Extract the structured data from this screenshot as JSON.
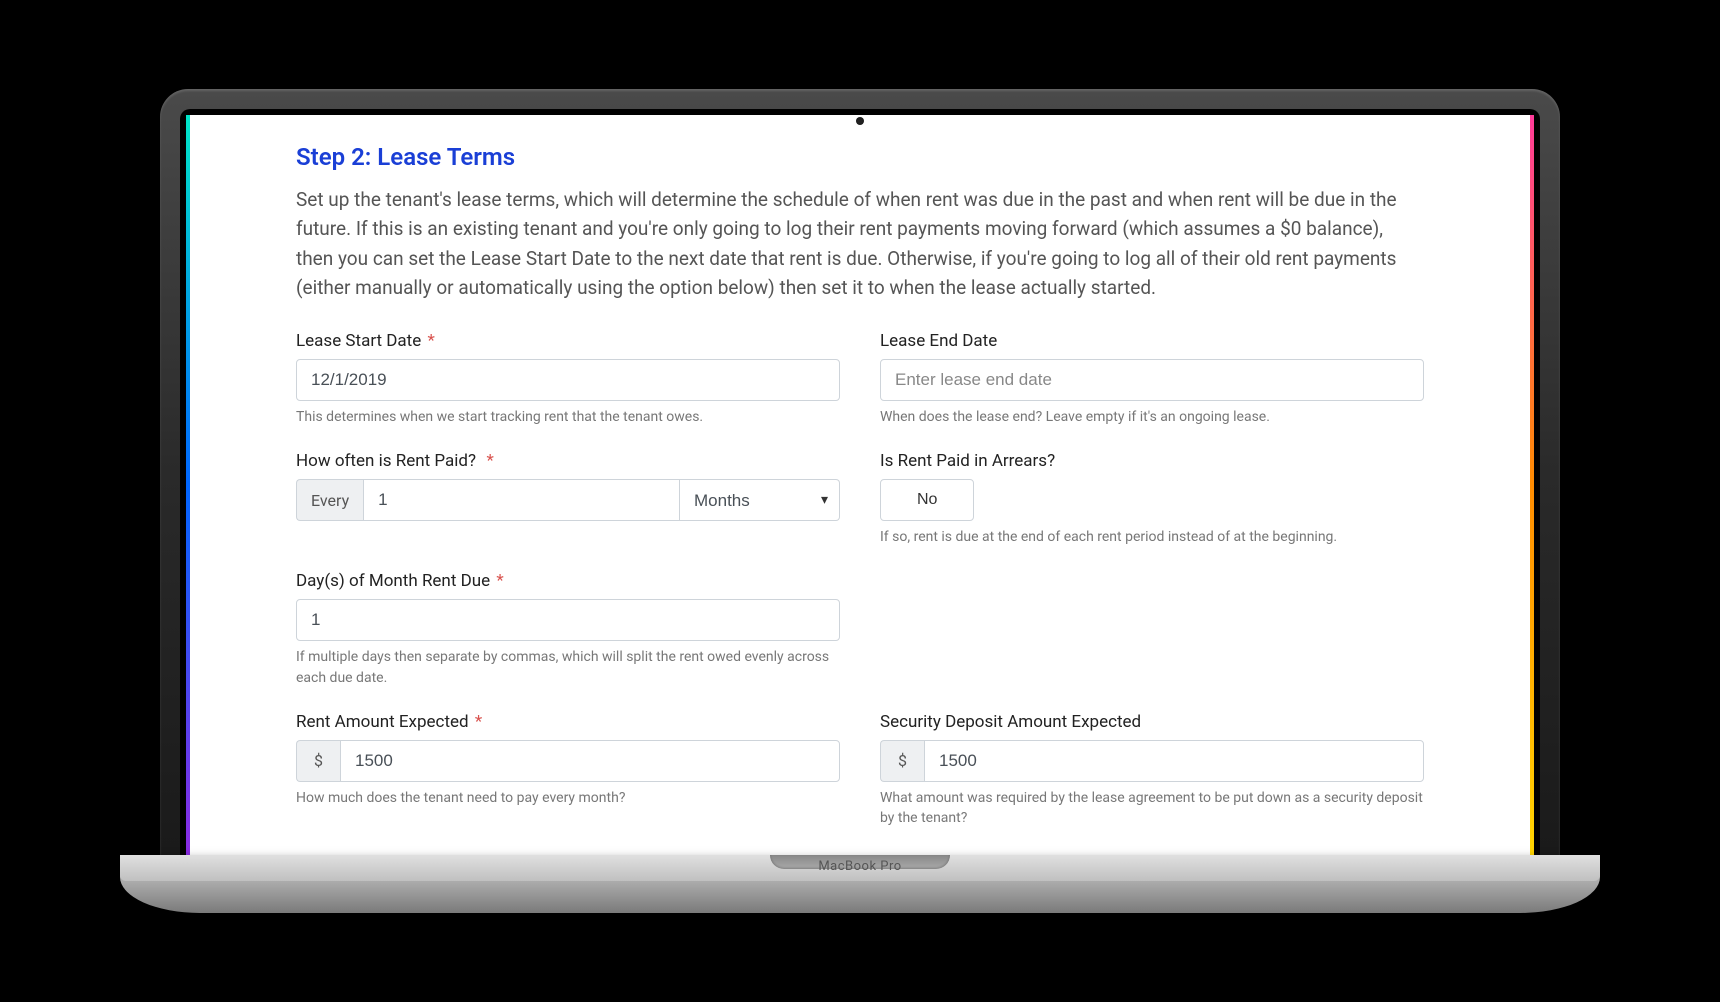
{
  "device": {
    "label": "MacBook Pro"
  },
  "step": {
    "title": "Step 2: Lease Terms",
    "description": "Set up the tenant's lease terms, which will determine the schedule of when rent was due in the past and when rent will be due in the future. If this is an existing tenant and you're only going to log their rent payments moving forward (which assumes a $0 balance), then you can set the Lease Start Date to the next date that rent is due. Otherwise, if you're going to log all of their old rent payments (either manually or automatically using the option below) then set it to when the lease actually started."
  },
  "fields": {
    "leaseStart": {
      "label": "Lease Start Date",
      "required": "*",
      "value": "12/1/2019",
      "help": "This determines when we start tracking rent that the tenant owes."
    },
    "leaseEnd": {
      "label": "Lease End Date",
      "placeholder": "Enter lease end date",
      "help": "When does the lease end? Leave empty if it's an ongoing lease."
    },
    "frequency": {
      "label": "How often is Rent Paid?",
      "required": "*",
      "prefix": "Every",
      "interval": "1",
      "unit": "Months"
    },
    "arrears": {
      "label": "Is Rent Paid in Arrears?",
      "value": "No",
      "help": "If so, rent is due at the end of each rent period instead of at the beginning."
    },
    "dueDays": {
      "label": "Day(s) of Month Rent Due",
      "required": "*",
      "value": "1",
      "help": "If multiple days then separate by commas, which will split the rent owed evenly across each due date."
    },
    "rent": {
      "label": "Rent Amount Expected",
      "required": "*",
      "currency": "$",
      "value": "1500",
      "help": "How much does the tenant need to pay every month?"
    },
    "deposit": {
      "label": "Security Deposit Amount Expected",
      "currency": "$",
      "value": "1500",
      "help": "What amount was required by the lease agreement to be put down as a security deposit by the tenant?"
    }
  }
}
